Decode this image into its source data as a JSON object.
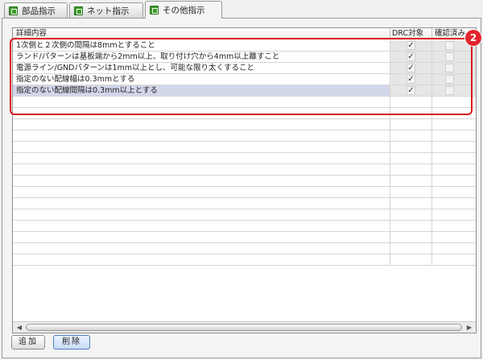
{
  "tabs": [
    {
      "label": "部品指示",
      "active": false
    },
    {
      "label": "ネット指示",
      "active": false
    },
    {
      "label": "その他指示",
      "active": true
    }
  ],
  "table": {
    "columns": [
      "詳細内容",
      "DRC対象",
      "確認済み"
    ],
    "rows": [
      {
        "text": "1次側と２次側の間隔は8mmとすること",
        "drc": "✓",
        "confirmed": ""
      },
      {
        "text": "ランド/パターンは基板端から2mm以上、取り付け穴から4mm以上離すこと",
        "drc": "✓",
        "confirmed": ""
      },
      {
        "text": "電源ライン/GNDパターンは1mm以上とし、可能な限り太くすること",
        "drc": "✓",
        "confirmed": ""
      },
      {
        "text": "指定のない配線幅は0.3mmとする",
        "drc": "✓",
        "confirmed": ""
      },
      {
        "text": "指定のない配線間隔は0.3mm以上とする",
        "drc": "✓",
        "confirmed": ""
      }
    ],
    "empty_rows": 15
  },
  "scroll_icons": {
    "left": "◀",
    "right": "▶"
  },
  "badge": "2",
  "buttons": {
    "add": "追加",
    "delete": "削除"
  },
  "colors": {
    "accent": "#d9161e",
    "tab_icon": "#3e9a2e",
    "selection": "#d3d7ea"
  }
}
